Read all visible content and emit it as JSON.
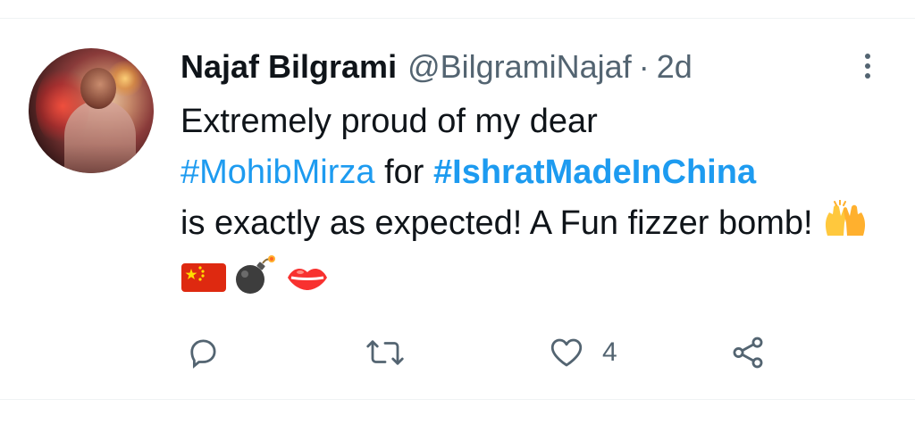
{
  "tweet": {
    "display_name": "Najaf Bilgrami",
    "handle": "@BilgramiNajaf",
    "separator": "·",
    "time": "2d",
    "text_part1": "Extremely proud of my dear",
    "hashtag1": "#MohibMirza",
    "text_part2": " for ",
    "hashtag2": "#IshratMadeInChina",
    "text_part3": "is exactly as expected! A Fun fizzer bomb! ",
    "emojis": [
      "raising-hands",
      "china-flag",
      "bomb",
      "kiss-mark"
    ],
    "hashtag_color": "#1d9bf0"
  },
  "actions": {
    "reply_icon": "reply-icon",
    "retweet_icon": "retweet-icon",
    "like_icon": "heart-icon",
    "like_count": "4",
    "share_icon": "share-icon"
  },
  "more_icon": "more-vertical-icon"
}
